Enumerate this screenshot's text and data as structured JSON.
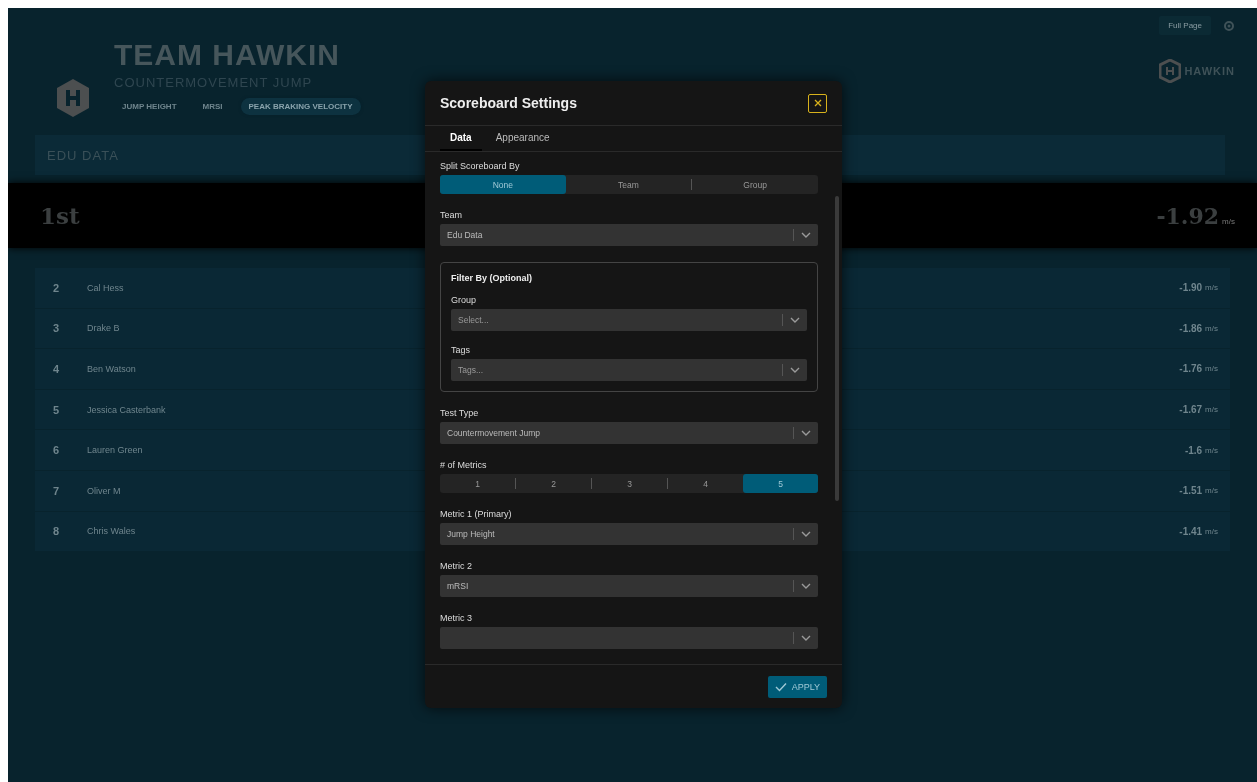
{
  "background": {
    "top_button": "Full Page",
    "team_title": "TEAM HAWKIN",
    "test_name": "COUNTERMOVEMENT JUMP",
    "metrics": [
      {
        "label": "JUMP HEIGHT",
        "selected": false
      },
      {
        "label": "MRSI",
        "selected": false
      },
      {
        "label": "PEAK BRAKING VELOCITY",
        "selected": true
      }
    ],
    "brand": "HAWKIN",
    "group": "EDU DATA",
    "leader": {
      "rank": "1st",
      "value": "-1.92",
      "unit": "m/s"
    },
    "rows": [
      {
        "rank": "2",
        "name": "Cal Hess",
        "value": "-1.90",
        "unit": "m/s"
      },
      {
        "rank": "3",
        "name": "Drake B",
        "value": "-1.86",
        "unit": "m/s"
      },
      {
        "rank": "4",
        "name": "Ben Watson",
        "value": "-1.76",
        "unit": "m/s"
      },
      {
        "rank": "5",
        "name": "Jessica Casterbank",
        "value": "-1.67",
        "unit": "m/s"
      },
      {
        "rank": "6",
        "name": "Lauren Green",
        "value": "-1.6",
        "unit": "m/s"
      },
      {
        "rank": "7",
        "name": "Oliver M",
        "value": "-1.51",
        "unit": "m/s"
      },
      {
        "rank": "8",
        "name": "Chris Wales",
        "value": "-1.41",
        "unit": "m/s"
      }
    ]
  },
  "modal": {
    "title": "Scoreboard Settings",
    "tabs": [
      {
        "label": "Data",
        "selected": true
      },
      {
        "label": "Appearance",
        "selected": false
      }
    ],
    "fields": [
      {
        "kind": "segmented",
        "label": "Split Scoreboard By",
        "options": [
          {
            "label": "None",
            "selected": true
          },
          {
            "label": "Team",
            "selected": false
          },
          {
            "label": "Group",
            "selected": false
          }
        ]
      },
      {
        "kind": "select",
        "label": "Team",
        "value": "Edu Data"
      },
      {
        "kind": "group",
        "title": "Filter By (Optional)",
        "fields": [
          {
            "kind": "select",
            "label": "Group",
            "placeholder": "Select..."
          },
          {
            "kind": "select",
            "label": "Tags",
            "placeholder": "Tags..."
          }
        ]
      },
      {
        "kind": "select",
        "label": "Test Type",
        "value": "Countermovement Jump"
      },
      {
        "kind": "segmented",
        "label": "# of Metrics",
        "options": [
          {
            "label": "1",
            "selected": false
          },
          {
            "label": "2",
            "selected": false
          },
          {
            "label": "3",
            "selected": false
          },
          {
            "label": "4",
            "selected": false
          },
          {
            "label": "5",
            "selected": true
          }
        ]
      },
      {
        "kind": "select",
        "label": "Metric 1 (Primary)",
        "value": "Jump Height"
      },
      {
        "kind": "select",
        "label": "Metric 2",
        "value": "mRSI"
      },
      {
        "kind": "select",
        "label": "Metric 3"
      }
    ],
    "apply": "APPLY"
  }
}
